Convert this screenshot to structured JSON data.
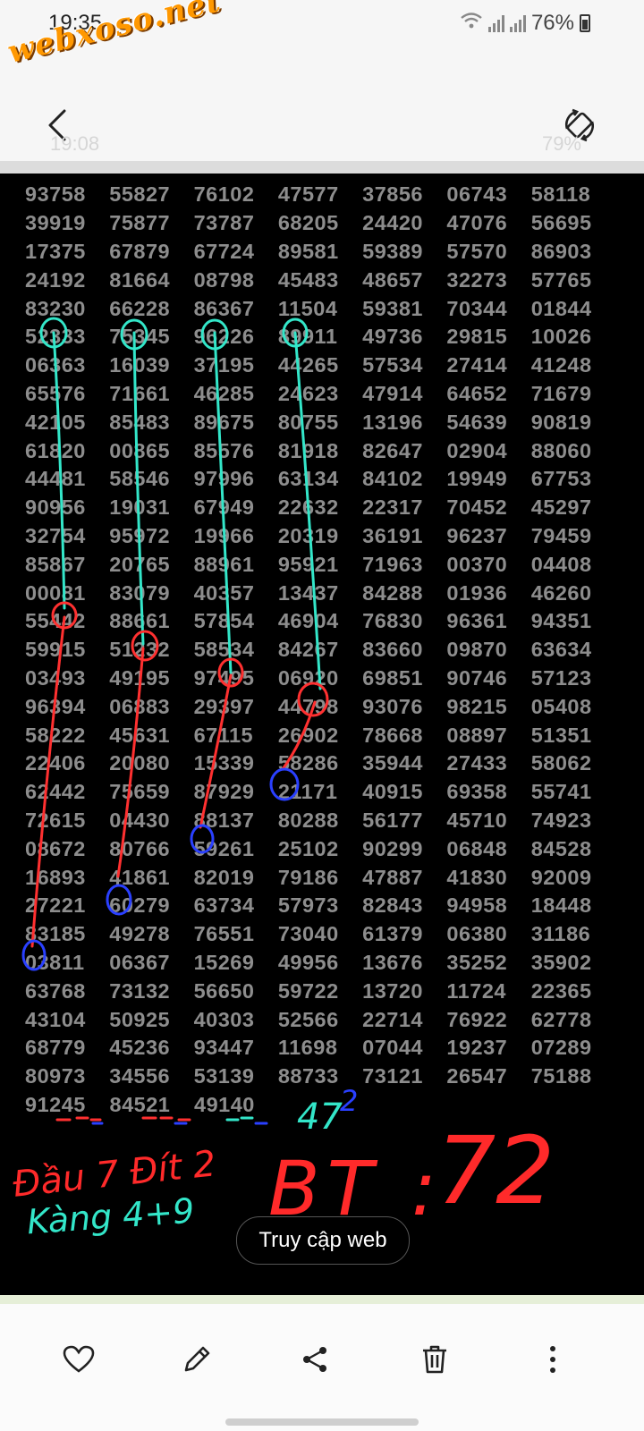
{
  "status_bar": {
    "time": "19:35",
    "battery": "76%"
  },
  "watermark": "webxoso.net",
  "ghost_status": {
    "time": "19:08",
    "battery": "79%"
  },
  "toolbar": {
    "back_icon": "chevron-left-icon",
    "rotate_icon": "rotate-icon"
  },
  "grid": [
    [
      "93758",
      "55827",
      "76102",
      "47577",
      "37856",
      "06743",
      "58118"
    ],
    [
      "39919",
      "75877",
      "73787",
      "68205",
      "24420",
      "47076",
      "56695"
    ],
    [
      "17375",
      "67879",
      "67724",
      "89581",
      "59389",
      "57570",
      "86903"
    ],
    [
      "24192",
      "81664",
      "08798",
      "45483",
      "48657",
      "32273",
      "57765"
    ],
    [
      "83230",
      "66228",
      "86367",
      "11504",
      "59381",
      "70344",
      "01844"
    ],
    [
      "52333",
      "75345",
      "96226",
      "89911",
      "49736",
      "29815",
      "10026"
    ],
    [
      "06363",
      "16039",
      "37195",
      "44265",
      "57534",
      "27414",
      "41248"
    ],
    [
      "65576",
      "71661",
      "46285",
      "24623",
      "47914",
      "64652",
      "71679"
    ],
    [
      "42105",
      "85483",
      "89675",
      "80755",
      "13196",
      "54639",
      "90819"
    ],
    [
      "61820",
      "00865",
      "85576",
      "81918",
      "82647",
      "02904",
      "88060"
    ],
    [
      "44481",
      "58546",
      "97996",
      "63134",
      "84102",
      "19949",
      "67753"
    ],
    [
      "90956",
      "19031",
      "67949",
      "22632",
      "22317",
      "70452",
      "45297"
    ],
    [
      "32754",
      "95972",
      "19966",
      "20319",
      "36191",
      "96237",
      "79459"
    ],
    [
      "85867",
      "20765",
      "88961",
      "95921",
      "71963",
      "00370",
      "04408"
    ],
    [
      "00081",
      "83079",
      "40357",
      "13437",
      "84288",
      "01936",
      "46260"
    ],
    [
      "55442",
      "88661",
      "57854",
      "46904",
      "76830",
      "96361",
      "94351"
    ],
    [
      "59915",
      "51232",
      "58534",
      "84267",
      "83660",
      "09870",
      "63634"
    ],
    [
      "03493",
      "49195",
      "97495",
      "06920",
      "69851",
      "90746",
      "57123"
    ],
    [
      "96394",
      "06883",
      "29397",
      "44798",
      "93076",
      "98215",
      "05408"
    ],
    [
      "58222",
      "45631",
      "67115",
      "26902",
      "78668",
      "08897",
      "51351"
    ],
    [
      "22406",
      "20080",
      "15339",
      "58286",
      "35944",
      "27433",
      "58062"
    ],
    [
      "62442",
      "75659",
      "87929",
      "21171",
      "40915",
      "69358",
      "55741"
    ],
    [
      "72615",
      "04430",
      "88137",
      "80288",
      "56177",
      "45710",
      "74923"
    ],
    [
      "08672",
      "80766",
      "59261",
      "25102",
      "90299",
      "06848",
      "84528"
    ],
    [
      "16893",
      "41861",
      "82019",
      "79186",
      "47887",
      "41830",
      "92009"
    ],
    [
      "27221",
      "60279",
      "63734",
      "57973",
      "82843",
      "94958",
      "18448"
    ],
    [
      "83185",
      "49278",
      "76551",
      "73040",
      "61379",
      "06380",
      "31186"
    ],
    [
      "03811",
      "06367",
      "15269",
      "49956",
      "13676",
      "35252",
      "35902"
    ],
    [
      "63768",
      "73132",
      "56650",
      "59722",
      "13720",
      "11724",
      "22365"
    ],
    [
      "43104",
      "50925",
      "40303",
      "52566",
      "22714",
      "76922",
      "62778"
    ],
    [
      "68779",
      "45236",
      "93447",
      "11698",
      "07044",
      "19237",
      "07289"
    ],
    [
      "80973",
      "34556",
      "53139",
      "88733",
      "73121",
      "26547",
      "75188"
    ],
    [
      "91245",
      "84521",
      "49140"
    ]
  ],
  "annotations": {
    "red_note": "Đầu 7 Đít 2",
    "cyan_note": "Kàng 4+9",
    "bt_label": "BT :",
    "bt_value": "72",
    "small_47": "47",
    "small_sup": "2"
  },
  "web_button": "Truy cập web",
  "actions": [
    {
      "name": "like-button",
      "icon": "heart-icon"
    },
    {
      "name": "edit-button",
      "icon": "pencil-icon"
    },
    {
      "name": "share-button",
      "icon": "share-icon"
    },
    {
      "name": "delete-button",
      "icon": "trash-icon"
    },
    {
      "name": "more-button",
      "icon": "more-vertical-icon"
    }
  ]
}
